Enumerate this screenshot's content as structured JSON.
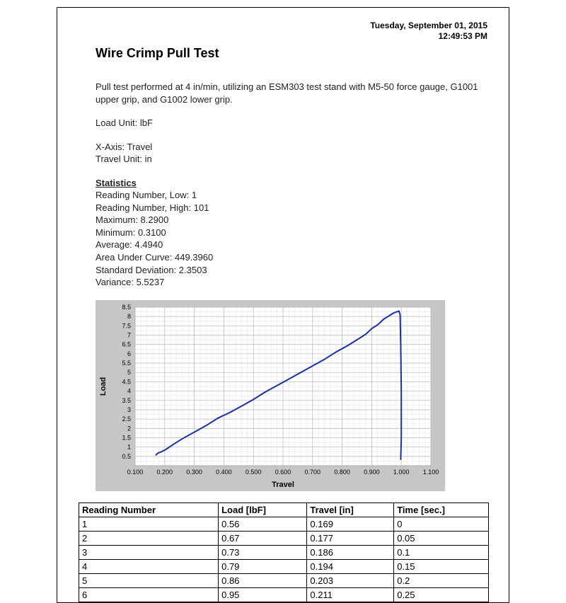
{
  "datetime_line1": "Tuesday, September 01, 2015",
  "datetime_line2": "12:49:53 PM",
  "title": "Wire Crimp Pull Test",
  "intro": "Pull test performed at 4 in/min, utilizing an ESM303 test stand with M5-50 force gauge, G1001 upper grip, and G1002 lower grip.",
  "load_unit_line": "Load Unit: lbF",
  "xaxis_line": "X-Axis: Travel",
  "travel_unit_line": "Travel Unit: in",
  "stats_header": "Statistics",
  "stats": {
    "reading_low": "Reading Number, Low: 1",
    "reading_high": "Reading Number, High: 101",
    "maximum": "Maximum: 8.2900",
    "minimum": "Minimum: 0.3100",
    "average": "Average: 4.4940",
    "auc": "Area Under Curve: 449.3960",
    "stddev": "Standard Deviation: 2.3503",
    "variance": "Variance: 5.5237"
  },
  "table": {
    "headers": [
      "Reading Number",
      "Load [lbF]",
      "Travel [in]",
      "Time [sec.]"
    ],
    "rows": [
      [
        "1",
        "0.56",
        "0.169",
        "0"
      ],
      [
        "2",
        "0.67",
        "0.177",
        "0.05"
      ],
      [
        "3",
        "0.73",
        "0.186",
        "0.1"
      ],
      [
        "4",
        "0.79",
        "0.194",
        "0.15"
      ],
      [
        "5",
        "0.86",
        "0.203",
        "0.2"
      ],
      [
        "6",
        "0.95",
        "0.211",
        "0.25"
      ]
    ]
  },
  "chart_data": {
    "type": "line",
    "title": "",
    "xlabel": "Travel",
    "ylabel": "Load",
    "xlim": [
      0.1,
      1.1
    ],
    "ylim": [
      0,
      8.5
    ],
    "xticks": [
      "0.100",
      "0.200",
      "0.300",
      "0.400",
      "0.500",
      "0.600",
      "0.700",
      "0.800",
      "0.900",
      "1.000",
      "1.100"
    ],
    "yticks": [
      "0.5",
      "1",
      "1.5",
      "2",
      "2.5",
      "3",
      "3.5",
      "4",
      "4.5",
      "5",
      "5.5",
      "6",
      "6.5",
      "7",
      "7.5",
      "8",
      "8.5"
    ],
    "series": [
      {
        "name": "Load",
        "color": "#1a2ea8",
        "x": [
          0.169,
          0.177,
          0.186,
          0.194,
          0.203,
          0.211,
          0.23,
          0.26,
          0.3,
          0.34,
          0.38,
          0.42,
          0.46,
          0.5,
          0.54,
          0.58,
          0.62,
          0.66,
          0.7,
          0.74,
          0.78,
          0.82,
          0.86,
          0.88,
          0.9,
          0.92,
          0.94,
          0.955,
          0.965,
          0.975,
          0.985,
          0.992,
          0.996,
          0.998,
          1.0,
          1.0,
          0.998
        ],
        "y": [
          0.56,
          0.67,
          0.73,
          0.79,
          0.86,
          0.95,
          1.15,
          1.45,
          1.8,
          2.15,
          2.55,
          2.85,
          3.2,
          3.55,
          3.95,
          4.3,
          4.65,
          5.0,
          5.35,
          5.7,
          6.1,
          6.45,
          6.85,
          7.05,
          7.35,
          7.55,
          7.85,
          8.0,
          8.1,
          8.2,
          8.25,
          8.29,
          8.1,
          6.5,
          4.0,
          1.5,
          0.31
        ]
      }
    ]
  }
}
